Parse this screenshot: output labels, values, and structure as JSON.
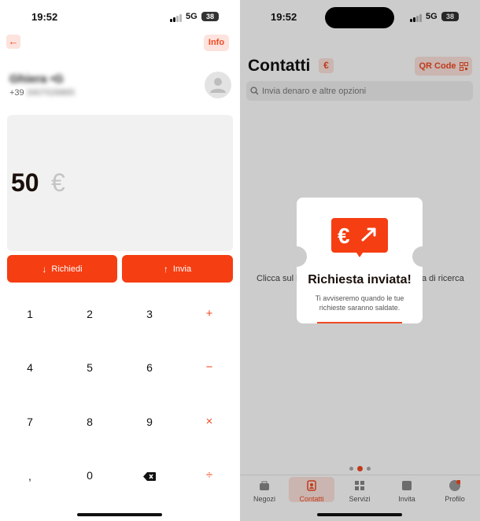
{
  "left": {
    "status": {
      "time": "19:52",
      "network": "5G",
      "battery": "38"
    },
    "header": {
      "back_icon": "arrow-left-icon",
      "info_label": "Info"
    },
    "contact": {
      "name": "Ghiera •G",
      "phone_prefix": "+39",
      "phone_rest": "3407026865"
    },
    "amount": {
      "value": "50",
      "currency": "€"
    },
    "actions": {
      "request_label": "Richiedi",
      "send_label": "Invia"
    },
    "keypad": {
      "row1": [
        "1",
        "2",
        "3",
        "+"
      ],
      "row2": [
        "4",
        "5",
        "6",
        "−"
      ],
      "row3": [
        "7",
        "8",
        "9",
        "×"
      ],
      "row4": [
        ",",
        "0",
        "÷"
      ],
      "backspace_icon": "backspace-icon"
    }
  },
  "right": {
    "status": {
      "time": "19:52",
      "network": "5G",
      "battery": "38"
    },
    "title": "Contatti",
    "euro_badge": "€",
    "qr_label": "QR Code",
    "search_placeholder": "Invia denaro e altre opzioni",
    "hint_left": "Clicca sul l",
    "hint_right": "a di ricerca",
    "popup": {
      "title": "Richiesta inviata!",
      "message": "Ti avviseremo quando le tue richieste saranno saldate.",
      "icon": "euro-request-icon"
    },
    "tabs": [
      {
        "label": "Negozi",
        "icon": "shop-icon"
      },
      {
        "label": "Contatti",
        "icon": "contacts-icon"
      },
      {
        "label": "Servizi",
        "icon": "grid-icon"
      },
      {
        "label": "Invita",
        "icon": "invite-icon"
      },
      {
        "label": "Profilo",
        "icon": "profile-icon"
      }
    ],
    "active_tab": "Contatti"
  },
  "colors": {
    "accent": "#f53e12",
    "accent_soft": "#fde3dd",
    "text": "#111111"
  }
}
